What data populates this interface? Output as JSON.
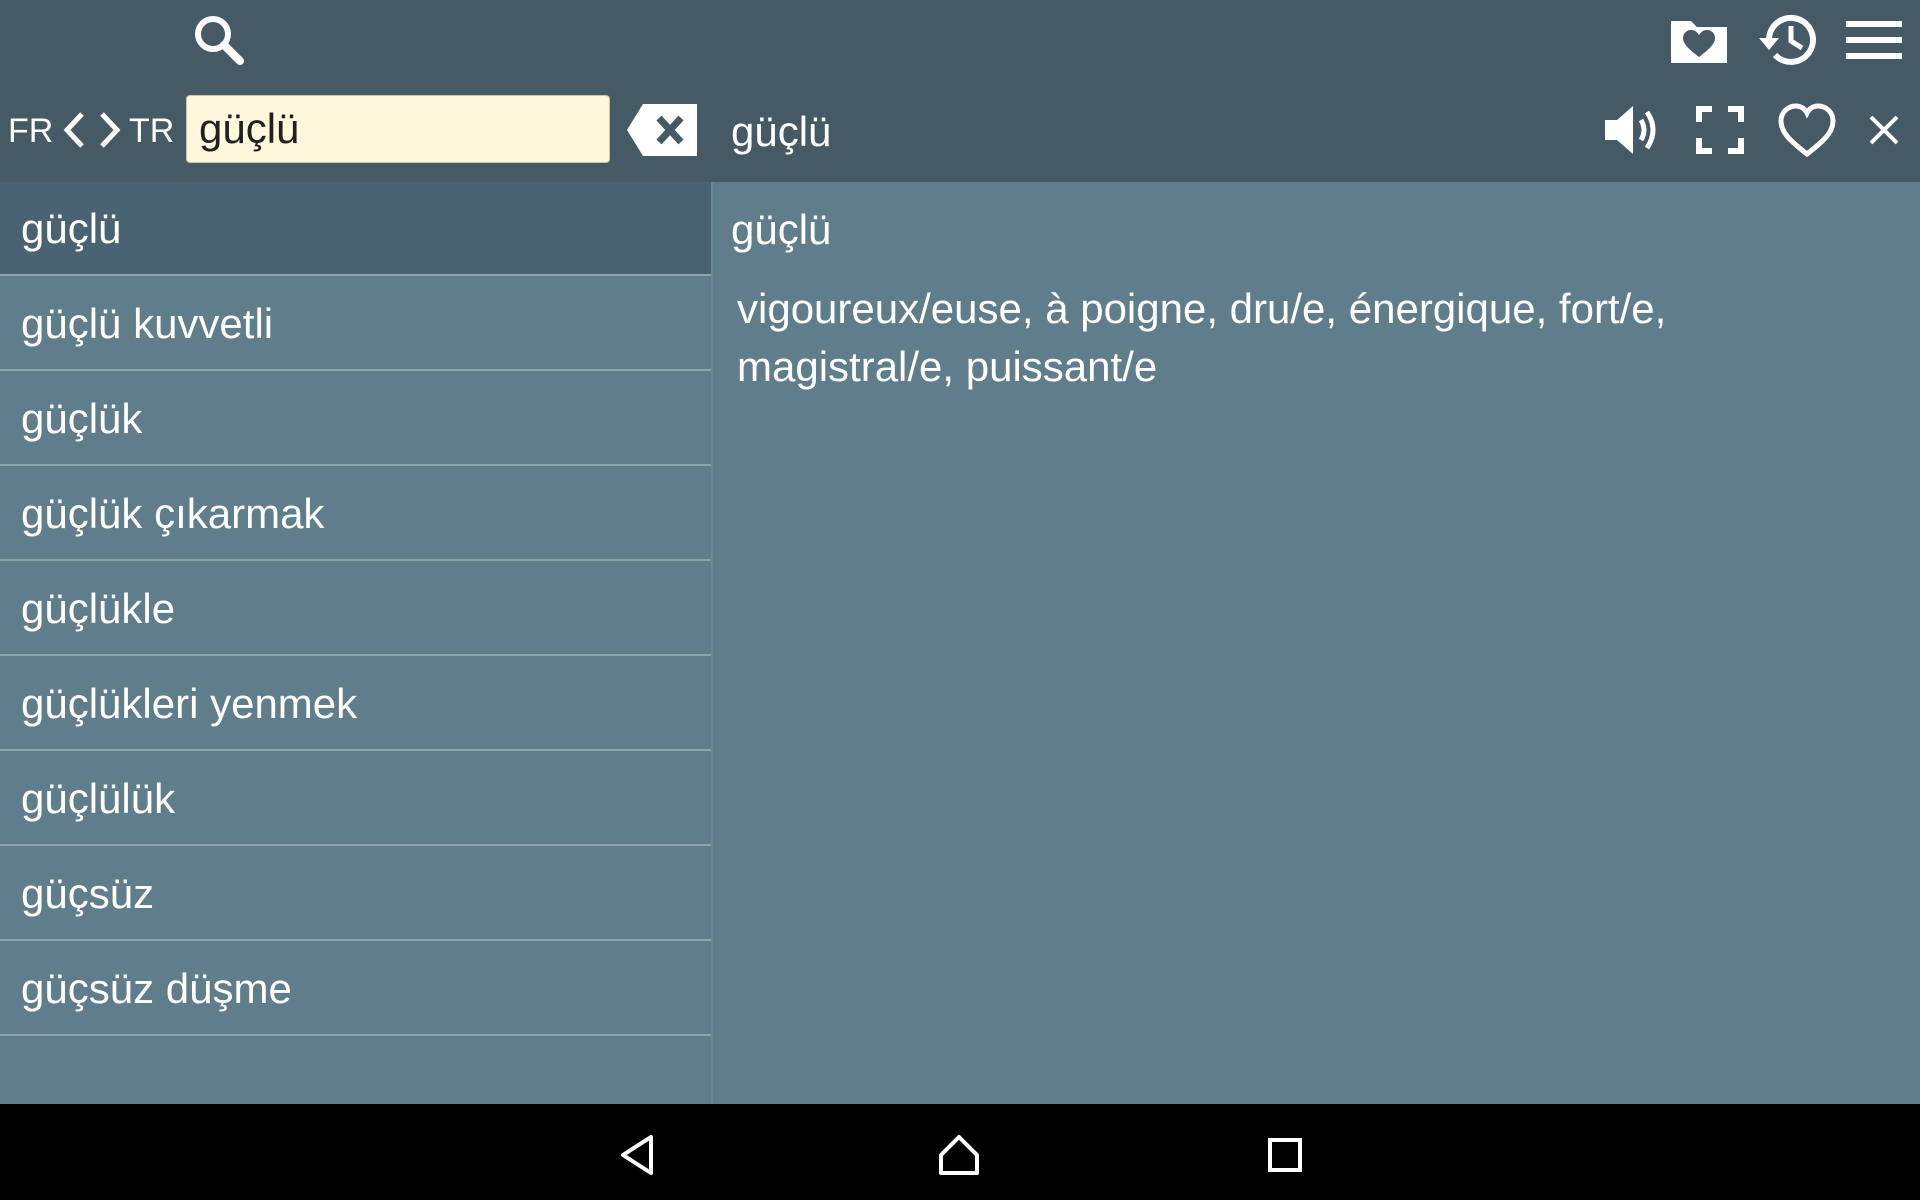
{
  "toolbar": {
    "search_icon": "search-icon",
    "favorites_icon": "favorites-folder-icon",
    "history_icon": "history-icon",
    "menu_icon": "menu-icon"
  },
  "languages": {
    "source": "FR",
    "target": "TR"
  },
  "search": {
    "value": "güçlü",
    "placeholder": ""
  },
  "header": {
    "word": "güçlü"
  },
  "results": [
    "güçlü",
    "güçlü kuvvetli",
    "güçlük",
    "güçlük çıkarmak",
    "güçlükle",
    "güçlükleri yenmek",
    "güçlülük",
    "güçsüz",
    "güçsüz düşme"
  ],
  "selected_index": 0,
  "entry": {
    "headword": "güçlü",
    "translation": "vigoureux/euse, à poigne, dru/e, énergique, fort/e, magistral/e, puissant/e"
  },
  "colors": {
    "toolbar_bg": "#455a64",
    "content_bg": "#607d8b",
    "selected_bg": "#4a6373",
    "search_bg": "#fff8dc",
    "nav_bg": "#000000"
  }
}
